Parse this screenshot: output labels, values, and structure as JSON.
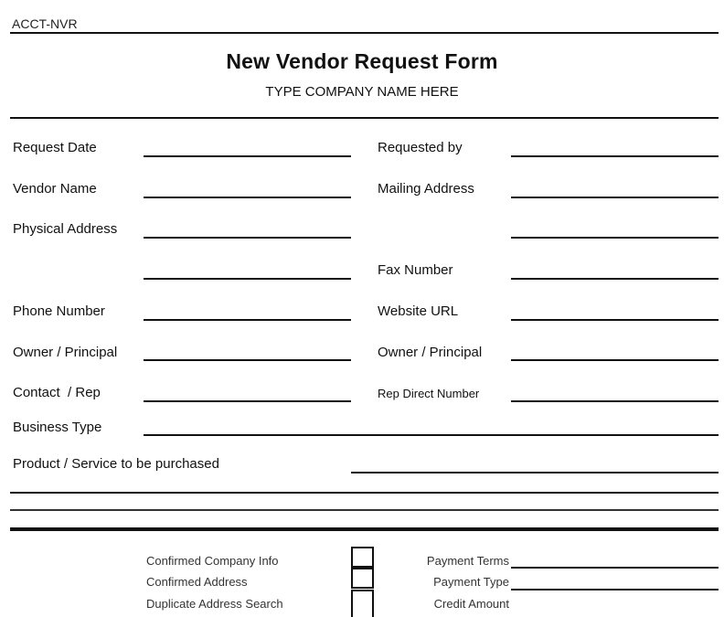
{
  "header": {
    "form_code": "ACCT-NVR",
    "title": "New Vendor Request Form",
    "company_placeholder": "TYPE COMPANY NAME HERE"
  },
  "fields_left": [
    {
      "label": "Request Date"
    },
    {
      "label": "Vendor Name"
    },
    {
      "label": "Physical Address"
    },
    {
      "label": ""
    },
    {
      "label": "Phone Number"
    },
    {
      "label": "Owner / Principal"
    },
    {
      "label": "Contact  / Rep"
    }
  ],
  "fields_right": [
    {
      "label": "Requested by"
    },
    {
      "label": "Mailing Address"
    },
    {
      "label": ""
    },
    {
      "label": "Fax Number"
    },
    {
      "label": "Website URL"
    },
    {
      "label": "Owner / Principal"
    },
    {
      "label": "Rep Direct Number"
    }
  ],
  "full_fields": {
    "business_type": "Business Type",
    "product_service": "Product / Service to be purchased"
  },
  "verification": {
    "checklist": [
      {
        "label": "Confirmed Company Info",
        "checked": false
      },
      {
        "label": "Confirmed Address",
        "checked": false
      },
      {
        "label": "Duplicate Address Search",
        "checked": false
      }
    ],
    "payment": [
      {
        "label": "Payment Terms"
      },
      {
        "label": "Payment Type"
      },
      {
        "label": "Credit Amount"
      }
    ]
  }
}
